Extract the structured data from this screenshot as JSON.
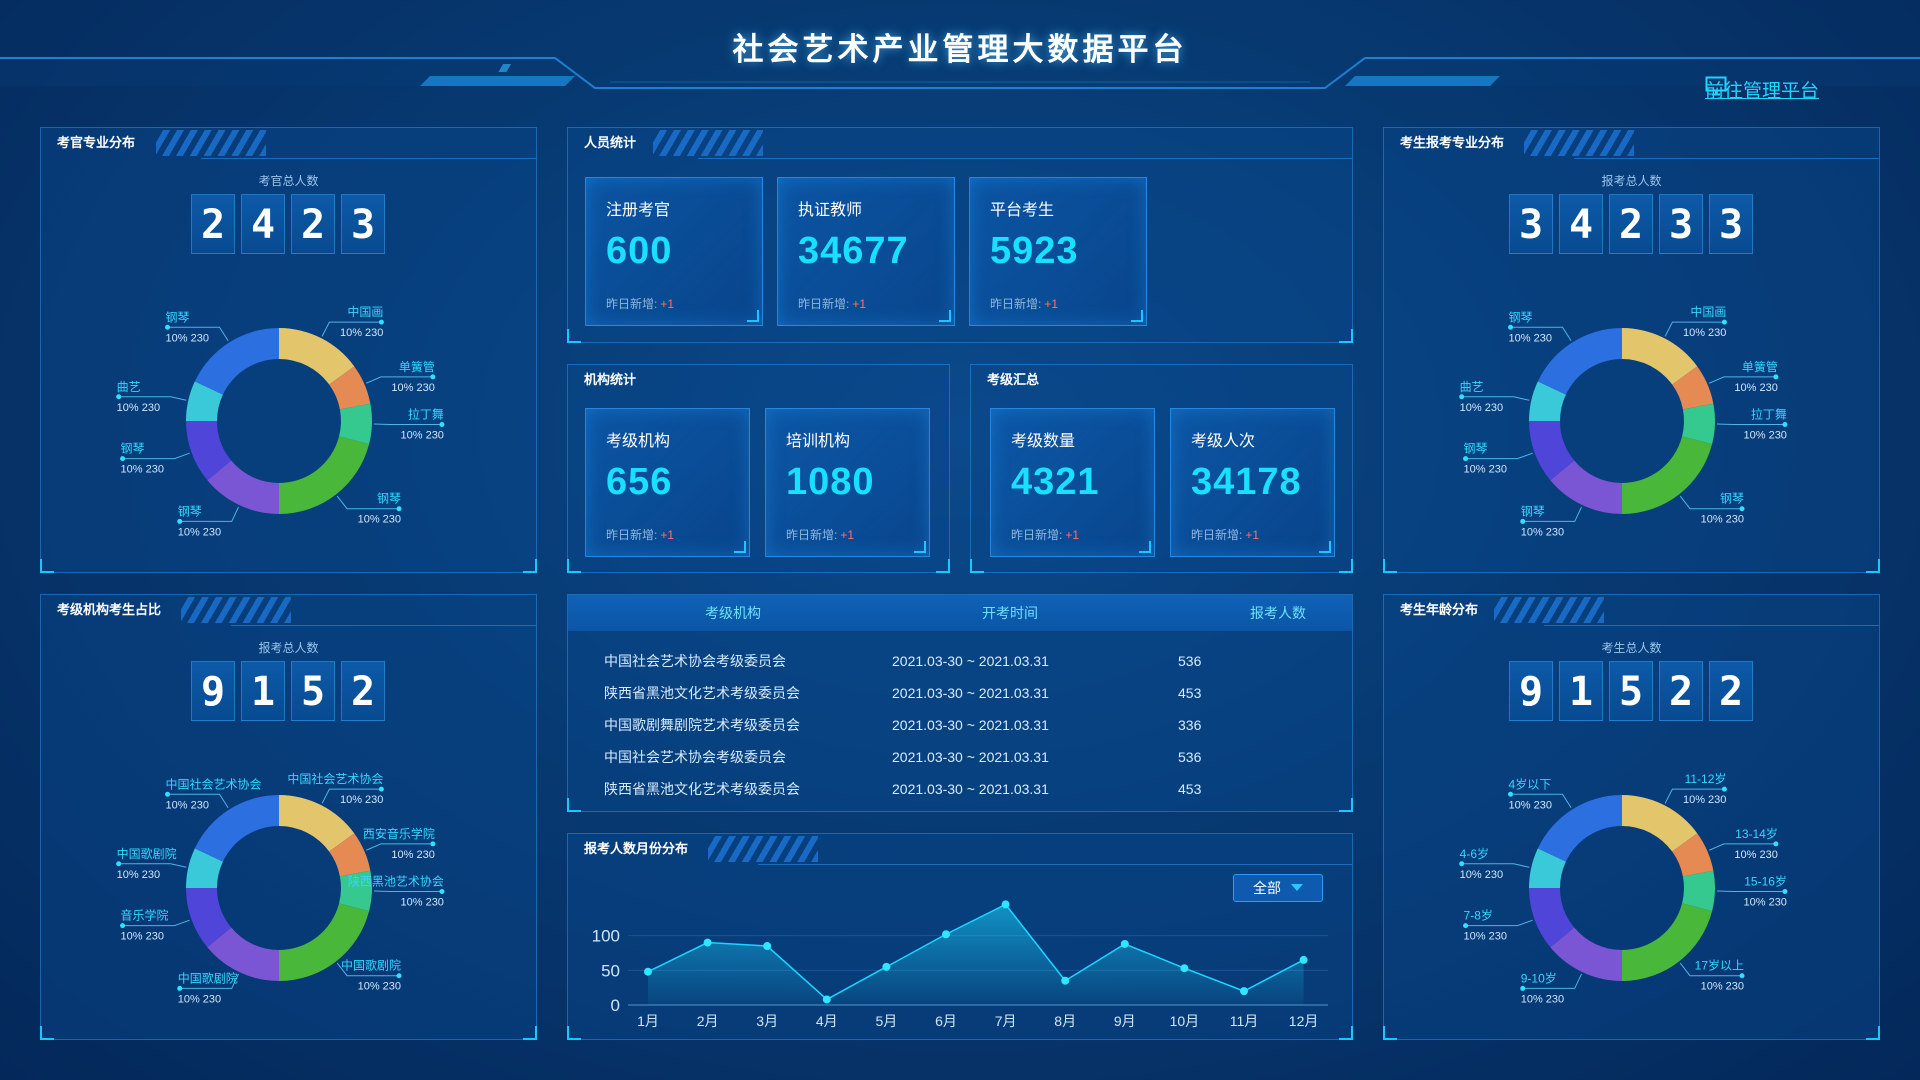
{
  "header": {
    "title": "社会艺术产业管理大数据平台",
    "mgmt_link": "前往管理平台"
  },
  "panels": {
    "examiner": {
      "title": "考官专业分布",
      "total_label": "考官总人数",
      "digits": [
        "2",
        "4",
        "2",
        "3"
      ]
    },
    "agency_ratio": {
      "title": "考级机构考生占比",
      "total_label": "报考总人数",
      "digits": [
        "9",
        "1",
        "5",
        "2"
      ]
    },
    "major": {
      "title": "考生报考专业分布",
      "total_label": "报考总人数",
      "digits": [
        "3",
        "4",
        "2",
        "3",
        "3"
      ]
    },
    "age": {
      "title": "考生年龄分布",
      "total_label": "考生总人数",
      "digits": [
        "9",
        "1",
        "5",
        "2",
        "2"
      ]
    },
    "personnel": {
      "title": "人员统计",
      "cards": [
        {
          "label": "注册考官",
          "value": "600",
          "inc_label": "昨日新增:",
          "inc": "+1"
        },
        {
          "label": "执证教师",
          "value": "34677",
          "inc_label": "昨日新增:",
          "inc": "+1"
        },
        {
          "label": "平台考生",
          "value": "5923",
          "inc_label": "昨日新增:",
          "inc": "+1"
        }
      ]
    },
    "institutions": {
      "title": "机构统计",
      "cards": [
        {
          "label": "考级机构",
          "value": "656",
          "inc_label": "昨日新增:",
          "inc": "+1"
        },
        {
          "label": "培训机构",
          "value": "1080",
          "inc_label": "昨日新增:",
          "inc": "+1"
        }
      ]
    },
    "exam_summary": {
      "title": "考级汇总",
      "cards": [
        {
          "label": "考级数量",
          "value": "4321",
          "inc_label": "昨日新增:",
          "inc": "+1"
        },
        {
          "label": "考级人次",
          "value": "34178",
          "inc_label": "昨日新增:",
          "inc": "+1"
        }
      ]
    },
    "table": {
      "headers": [
        "考级机构",
        "开考时间",
        "报考人数"
      ],
      "rows": [
        [
          "中国社会艺术协会考级委员会",
          "2021.03-30 ~ 2021.03.31",
          "536"
        ],
        [
          "陕西省黑池文化艺术考级委员会",
          "2021.03-30 ~ 2021.03.31",
          "453"
        ],
        [
          "中国歌剧舞剧院艺术考级委员会",
          "2021.03-30 ~ 2021.03.31",
          "336"
        ],
        [
          "中国社会艺术协会考级委员会",
          "2021.03-30 ~ 2021.03.31",
          "536"
        ],
        [
          "陕西省黑池文化艺术考级委员会",
          "2021.03-30 ~ 2021.03.31",
          "453"
        ]
      ]
    },
    "monthly": {
      "title": "报考人数月份分布",
      "filter": "全部"
    }
  },
  "chart_data": [
    {
      "type": "pie",
      "name": "examiner-donut",
      "categories": [
        "中国画",
        "单簧管",
        "拉丁舞",
        "钢琴",
        "钢琴",
        "钢琴",
        "曲艺",
        "钢琴"
      ],
      "values": [
        15,
        7,
        7,
        21,
        14,
        11,
        7,
        18
      ],
      "label_text": "10%  230",
      "colors": [
        "#e3c66c",
        "#e48a52",
        "#35c88f",
        "#49b739",
        "#7a55d4",
        "#4f45d9",
        "#3ac9d9",
        "#2c6fe0"
      ]
    },
    {
      "type": "pie",
      "name": "agency-donut",
      "categories": [
        "中国社会艺术协会",
        "西安音乐学院",
        "陕西黑池艺术协会",
        "中国歌剧院",
        "中国歌剧院",
        "音乐学院",
        "中国歌剧院",
        "中国社会艺术协会"
      ],
      "values": [
        15,
        7,
        7,
        21,
        14,
        11,
        7,
        18
      ],
      "label_text": "10%  230",
      "colors": [
        "#e3c66c",
        "#e48a52",
        "#35c88f",
        "#49b739",
        "#7a55d4",
        "#4f45d9",
        "#3ac9d9",
        "#2c6fe0"
      ]
    },
    {
      "type": "pie",
      "name": "major-donut",
      "categories": [
        "中国画",
        "单簧管",
        "拉丁舞",
        "钢琴",
        "钢琴",
        "钢琴",
        "曲艺",
        "钢琴"
      ],
      "values": [
        15,
        7,
        7,
        21,
        14,
        11,
        7,
        18
      ],
      "label_text": "10%  230",
      "colors": [
        "#e3c66c",
        "#e48a52",
        "#35c88f",
        "#49b739",
        "#7a55d4",
        "#4f45d9",
        "#3ac9d9",
        "#2c6fe0"
      ]
    },
    {
      "type": "pie",
      "name": "age-donut",
      "categories": [
        "11-12岁",
        "13-14岁",
        "15-16岁",
        "17岁以上",
        "9-10岁",
        "7-8岁",
        "4-6岁",
        "4岁以下"
      ],
      "values": [
        15,
        7,
        7,
        21,
        14,
        11,
        7,
        18
      ],
      "label_text": "10%  230",
      "colors": [
        "#e3c66c",
        "#e48a52",
        "#35c88f",
        "#49b739",
        "#7a55d4",
        "#4f45d9",
        "#3ac9d9",
        "#2c6fe0"
      ]
    },
    {
      "type": "area",
      "name": "monthly-line",
      "title": "报考人数月份分布",
      "categories": [
        "1月",
        "2月",
        "3月",
        "4月",
        "5月",
        "6月",
        "7月",
        "8月",
        "9月",
        "10月",
        "11月",
        "12月"
      ],
      "values": [
        48,
        90,
        85,
        8,
        55,
        102,
        145,
        35,
        88,
        53,
        20,
        65
      ],
      "yticks": [
        0,
        50,
        100
      ],
      "ylim": [
        0,
        160
      ],
      "grid": true,
      "color": "#19d6ff"
    }
  ]
}
